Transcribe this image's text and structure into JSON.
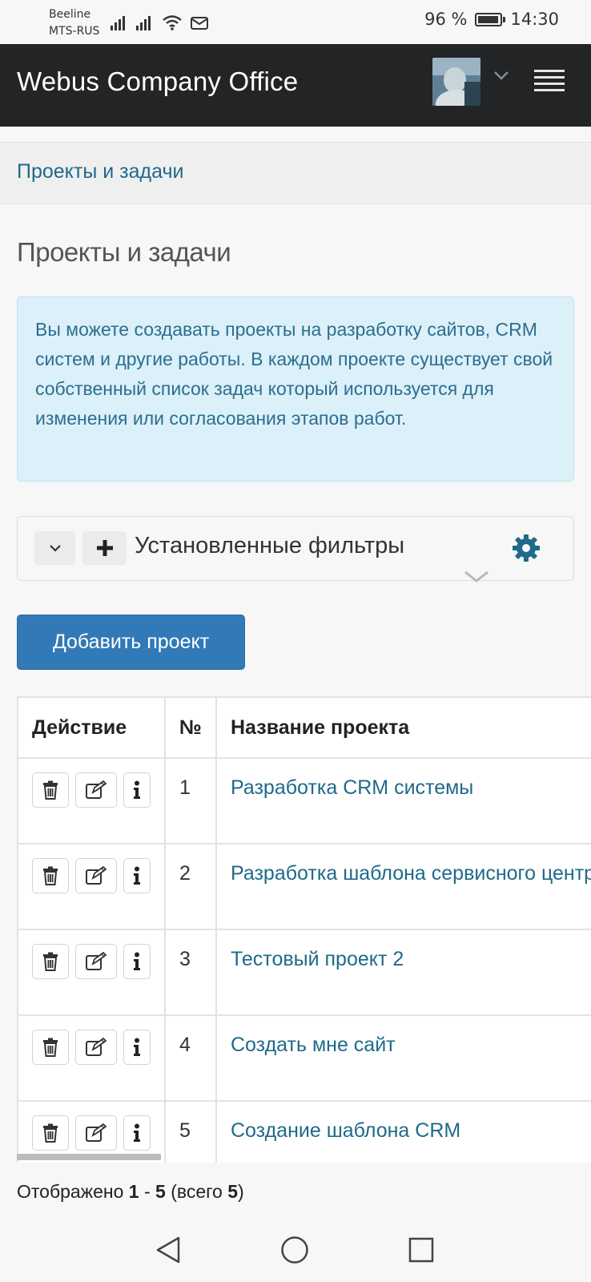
{
  "status_bar": {
    "carrier1": "Beeline",
    "carrier2": "MTS-RUS",
    "battery_percent": "96 %",
    "battery_level": 0.96,
    "time": "14:30"
  },
  "navbar": {
    "brand": "Webus Company Office"
  },
  "breadcrumb": {
    "item": "Проекты и задачи"
  },
  "page": {
    "title": "Проекты и задачи",
    "alert": "Вы можете создавать проекты на разработку сайтов, CRM систем и другие работы. В каждом проекте существует свой собственный список задач который используется для изменения или согласования этапов работ."
  },
  "filters": {
    "label": "Установленные фильтры"
  },
  "add_button": {
    "label": "Добавить проект"
  },
  "table": {
    "headers": [
      "Действие",
      "№",
      "Название проекта"
    ],
    "rows": [
      {
        "num": "1",
        "name": "Разработка CRM системы"
      },
      {
        "num": "2",
        "name": "Разработка шаблона сервисного центра"
      },
      {
        "num": "3",
        "name": "Тестовый проект 2"
      },
      {
        "num": "4",
        "name": "Создать мне сайт"
      },
      {
        "num": "5",
        "name": "Создание шаблона CRM"
      }
    ]
  },
  "pager": {
    "prefix": "Отображено ",
    "from": "1",
    "sep": " - ",
    "to": "5",
    "mid": " (всего ",
    "total": "5",
    "suffix": ")"
  },
  "colors": {
    "navbar_bg": "#222426",
    "link": "#1f6a8a",
    "primary_button": "#3279b7",
    "alert_bg": "#dcf0f9"
  },
  "icons": {
    "signal": "signal-icon",
    "wifi": "wifi-icon",
    "mail": "mail-icon",
    "battery": "battery-icon",
    "chevron": "chevron-down-icon",
    "menu": "hamburger-menu-icon",
    "plus": "plus-icon",
    "gear": "gear-icon",
    "trash": "trash-icon",
    "edit": "edit-icon",
    "info": "info-icon",
    "back": "back-icon",
    "home": "home-icon",
    "recent": "recent-apps-icon"
  }
}
